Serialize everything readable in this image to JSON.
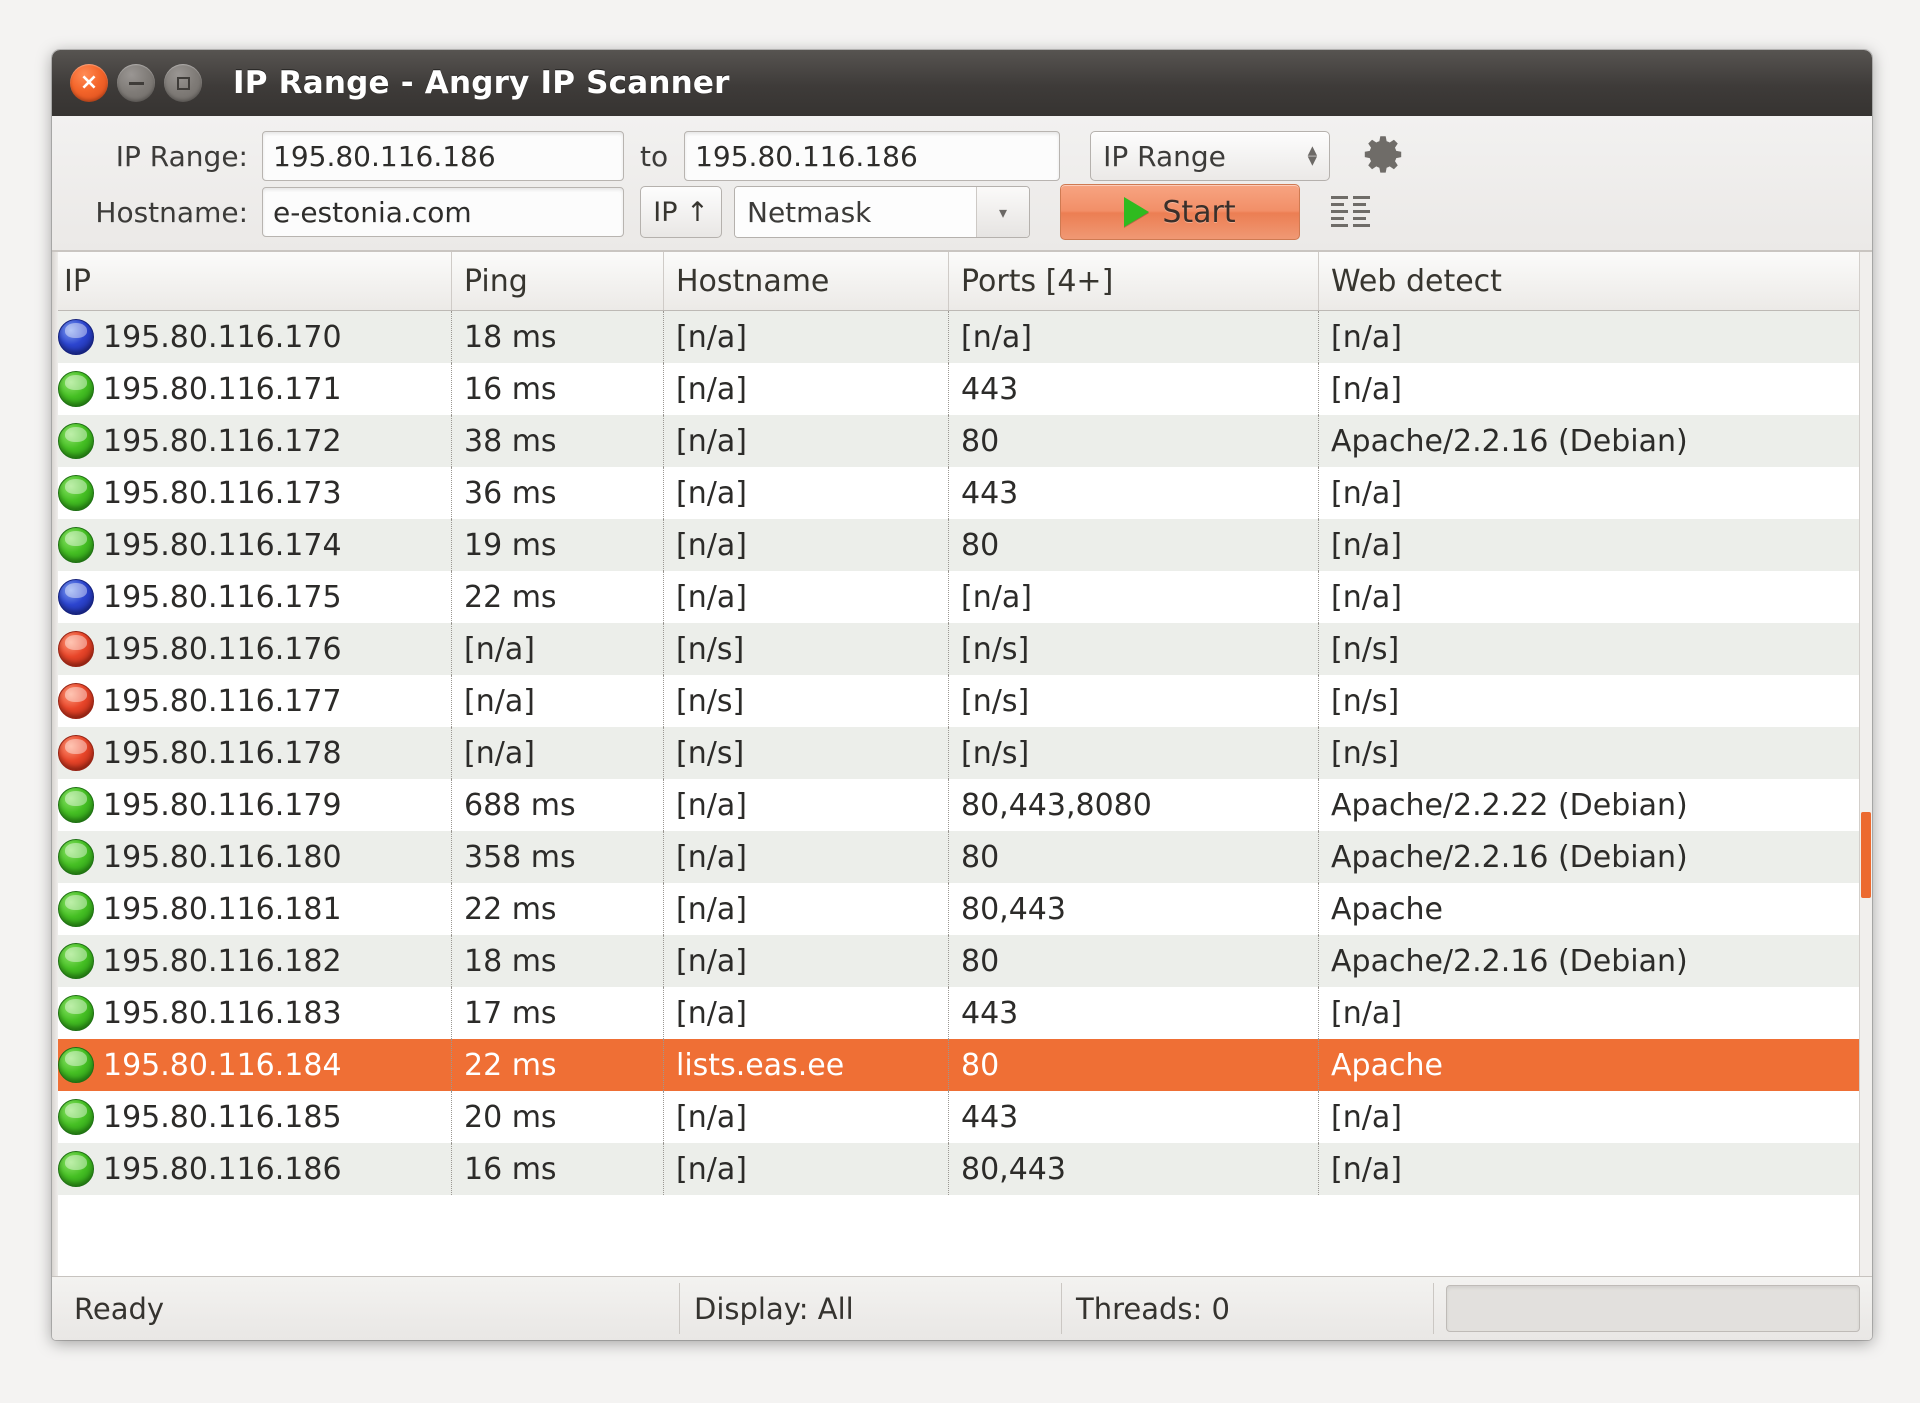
{
  "window": {
    "title": "IP Range - Angry IP Scanner",
    "close_label": "×",
    "minimize_label": "−",
    "maximize_label": ""
  },
  "toolbar": {
    "ip_range_label": "IP Range:",
    "ip_from_value": "195.80.116.186",
    "to_label": "to",
    "ip_to_value": "195.80.116.186",
    "feeder_value": "IP Range",
    "spin_up": "▴",
    "spin_down": "▾",
    "hostname_label": "Hostname:",
    "hostname_value": "e-estonia.com",
    "ip_up_label": "IP ↑",
    "netmask_value": "Netmask",
    "netmask_arrow": "▾",
    "start_label": "Start"
  },
  "table": {
    "columns": [
      "IP",
      "Ping",
      "Hostname",
      "Ports [4+]",
      "Web detect"
    ],
    "rows": [
      {
        "status": "blue",
        "ip": "195.80.116.170",
        "ping": "18 ms",
        "hostname": "[n/a]",
        "ports": "[n/a]",
        "web": "[n/a]"
      },
      {
        "status": "green",
        "ip": "195.80.116.171",
        "ping": "16 ms",
        "hostname": "[n/a]",
        "ports": "443",
        "web": "[n/a]"
      },
      {
        "status": "green",
        "ip": "195.80.116.172",
        "ping": "38 ms",
        "hostname": "[n/a]",
        "ports": "80",
        "web": "Apache/2.2.16 (Debian)"
      },
      {
        "status": "green",
        "ip": "195.80.116.173",
        "ping": "36 ms",
        "hostname": "[n/a]",
        "ports": "443",
        "web": "[n/a]"
      },
      {
        "status": "green",
        "ip": "195.80.116.174",
        "ping": "19 ms",
        "hostname": "[n/a]",
        "ports": "80",
        "web": "[n/a]"
      },
      {
        "status": "blue",
        "ip": "195.80.116.175",
        "ping": "22 ms",
        "hostname": "[n/a]",
        "ports": "[n/a]",
        "web": "[n/a]"
      },
      {
        "status": "red",
        "ip": "195.80.116.176",
        "ping": "[n/a]",
        "hostname": "[n/s]",
        "ports": "[n/s]",
        "web": "[n/s]"
      },
      {
        "status": "red",
        "ip": "195.80.116.177",
        "ping": "[n/a]",
        "hostname": "[n/s]",
        "ports": "[n/s]",
        "web": "[n/s]"
      },
      {
        "status": "red",
        "ip": "195.80.116.178",
        "ping": "[n/a]",
        "hostname": "[n/s]",
        "ports": "[n/s]",
        "web": "[n/s]"
      },
      {
        "status": "green",
        "ip": "195.80.116.179",
        "ping": "688 ms",
        "hostname": "[n/a]",
        "ports": "80,443,8080",
        "web": "Apache/2.2.22 (Debian)"
      },
      {
        "status": "green",
        "ip": "195.80.116.180",
        "ping": "358 ms",
        "hostname": "[n/a]",
        "ports": "80",
        "web": "Apache/2.2.16 (Debian)"
      },
      {
        "status": "green",
        "ip": "195.80.116.181",
        "ping": "22 ms",
        "hostname": "[n/a]",
        "ports": "80,443",
        "web": "Apache"
      },
      {
        "status": "green",
        "ip": "195.80.116.182",
        "ping": "18 ms",
        "hostname": "[n/a]",
        "ports": "80",
        "web": "Apache/2.2.16 (Debian)"
      },
      {
        "status": "green",
        "ip": "195.80.116.183",
        "ping": "17 ms",
        "hostname": "[n/a]",
        "ports": "443",
        "web": "[n/a]"
      },
      {
        "status": "green",
        "ip": "195.80.116.184",
        "ping": "22 ms",
        "hostname": "lists.eas.ee",
        "ports": "80",
        "web": "Apache",
        "selected": true
      },
      {
        "status": "green",
        "ip": "195.80.116.185",
        "ping": "20 ms",
        "hostname": "[n/a]",
        "ports": "443",
        "web": "[n/a]"
      },
      {
        "status": "green",
        "ip": "195.80.116.186",
        "ping": "16 ms",
        "hostname": "[n/a]",
        "ports": "80,443",
        "web": "[n/a]"
      }
    ]
  },
  "statusbar": {
    "ready": "Ready",
    "display": "Display: All",
    "threads": "Threads: 0"
  },
  "colors": {
    "accent": "#ef6f35",
    "titlebar": "#3e3b39",
    "start_button": "#f28f68",
    "status_green": "#46c024",
    "status_blue": "#2c45cf",
    "status_red": "#e8462a"
  }
}
